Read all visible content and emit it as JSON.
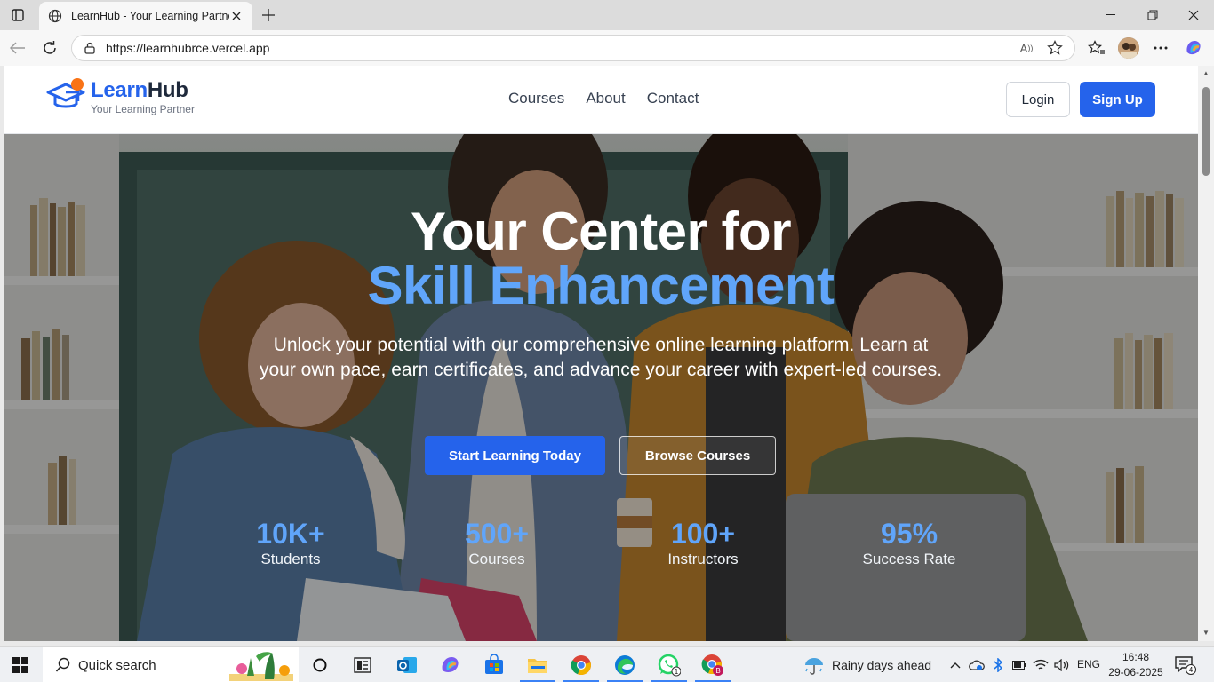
{
  "browser": {
    "tab_title": "LearnHub - Your Learning Partner",
    "url": "https://learnhubrce.vercel.app"
  },
  "site": {
    "logo_name_part1": "Learn",
    "logo_name_part2": "Hub",
    "logo_tagline": "Your Learning Partner",
    "nav": [
      "Courses",
      "About",
      "Contact"
    ],
    "login_label": "Login",
    "signup_label": "Sign Up",
    "brand_color": "#2563eb",
    "accent_color": "#60a5fa"
  },
  "hero": {
    "title_line1": "Your Center for",
    "title_line2": "Skill Enhancement",
    "subtitle": "Unlock your potential with our comprehensive online learning platform. Learn at your own pace, earn certificates, and advance your career with expert-led courses.",
    "primary_cta": "Start Learning Today",
    "secondary_cta": "Browse Courses",
    "stats": [
      {
        "value": "10K+",
        "label": "Students"
      },
      {
        "value": "500+",
        "label": "Courses"
      },
      {
        "value": "100+",
        "label": "Instructors"
      },
      {
        "value": "95%",
        "label": "Success Rate"
      }
    ]
  },
  "taskbar": {
    "search_placeholder": "Quick search",
    "weather": "Rainy days ahead",
    "language": "ENG",
    "time": "16:48",
    "date": "29-06-2025",
    "notification_count": "4",
    "whatsapp_badge": "1"
  }
}
